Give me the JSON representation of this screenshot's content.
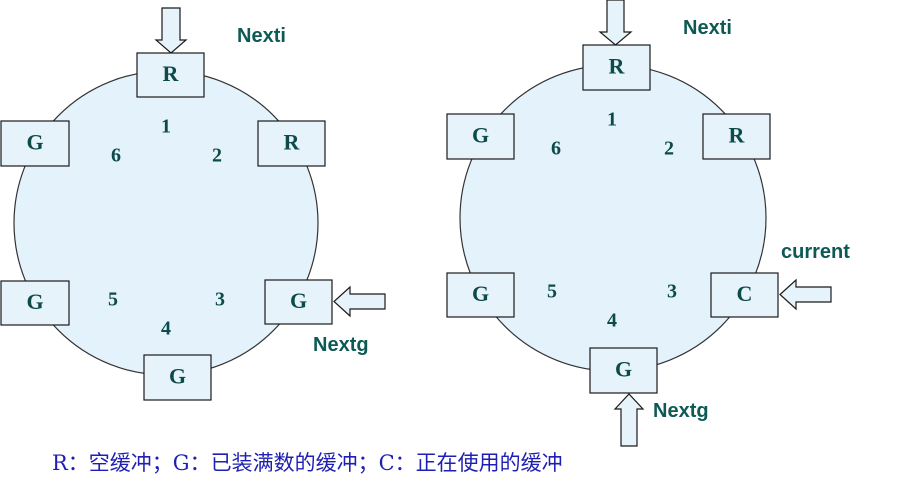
{
  "left_ring": {
    "buffers": [
      "R",
      "R",
      "G",
      "G",
      "G",
      "G"
    ],
    "slot_numbers": [
      "1",
      "2",
      "3",
      "4",
      "5",
      "6"
    ],
    "nexti_label": "Nexti",
    "nextg_label": "Nextg"
  },
  "right_ring": {
    "buffers": [
      "R",
      "R",
      "C",
      "G",
      "G",
      "G"
    ],
    "slot_numbers": [
      "1",
      "2",
      "3",
      "4",
      "5",
      "6"
    ],
    "nexti_label": "Nexti",
    "nextg_label": "Nextg",
    "current_label": "current"
  },
  "legend": "R：空缓冲；G：已装满数的缓冲；C：正在使用的缓冲",
  "colors": {
    "fill": "#e4f2fb",
    "text": "#0d4a4a",
    "legend": "#1f1fb4"
  }
}
